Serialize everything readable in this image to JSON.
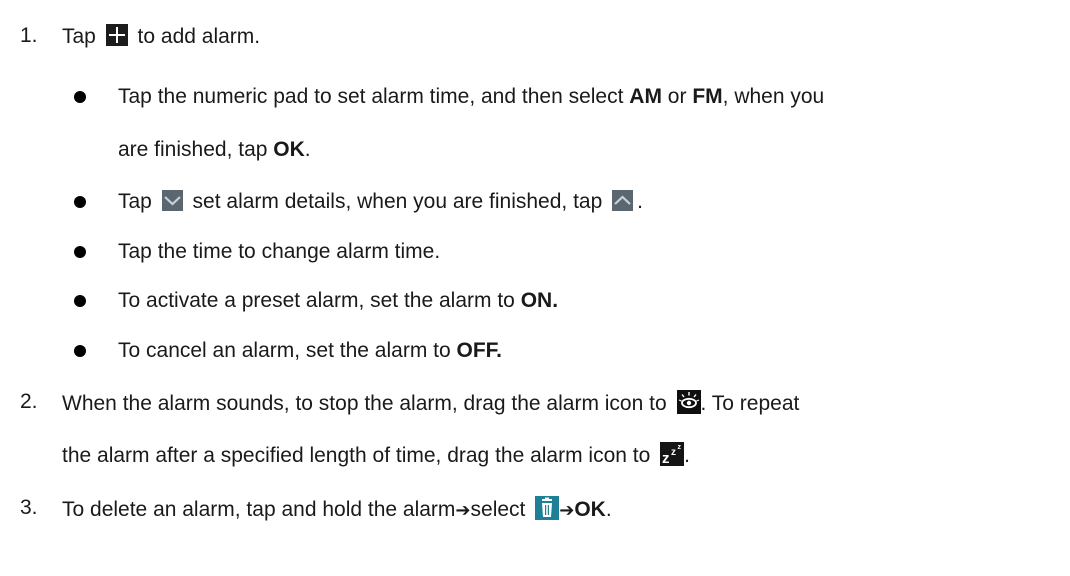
{
  "colors": {
    "icon_bg": "#1c1c1c",
    "chevron_bg": "#5a6670",
    "eye_bg": "#0f0f0f",
    "trash_bg": "#1f7f97"
  },
  "icons": {
    "plus": "plus-icon",
    "chevron_down": "chevron-down-icon",
    "chevron_up": "chevron-up-icon",
    "dismiss": "eye-sun-icon",
    "snooze": "snooze-zzz-icon",
    "delete": "trash-icon",
    "arrow": "right-arrow-icon"
  },
  "step1": {
    "number": "1.",
    "text_a": "Tap",
    "text_b": "to add alarm.",
    "bullets": [
      {
        "line1_a": "Tap the numeric pad to set alarm time, and then select",
        "b1": "AM",
        "or": "or",
        "b2": "FM",
        "line1_c": ", when you",
        "line2_a": "are finished, tap",
        "b3": "OK",
        "line2_c": "."
      },
      {
        "a": "Tap",
        "b": "set alarm details, when you are finished, tap",
        "c": "."
      },
      {
        "text": "Tap the time to change alarm time."
      },
      {
        "a": "To activate a preset alarm, set the alarm to",
        "b": "ON."
      },
      {
        "a": "To cancel an alarm, set the alarm to",
        "b": "OFF."
      }
    ]
  },
  "step2": {
    "number": "2.",
    "line1_a": "When the alarm sounds, to stop the alarm, drag the alarm icon to",
    "line1_b": ". To repeat",
    "line2_a": "the alarm after a specified length of time, drag the alarm icon to",
    "line2_b": "."
  },
  "step3": {
    "number": "3.",
    "a": "To delete an alarm, tap and hold the alarm",
    "arrow": "➔",
    "b": "select",
    "c": "OK",
    "d": "."
  }
}
